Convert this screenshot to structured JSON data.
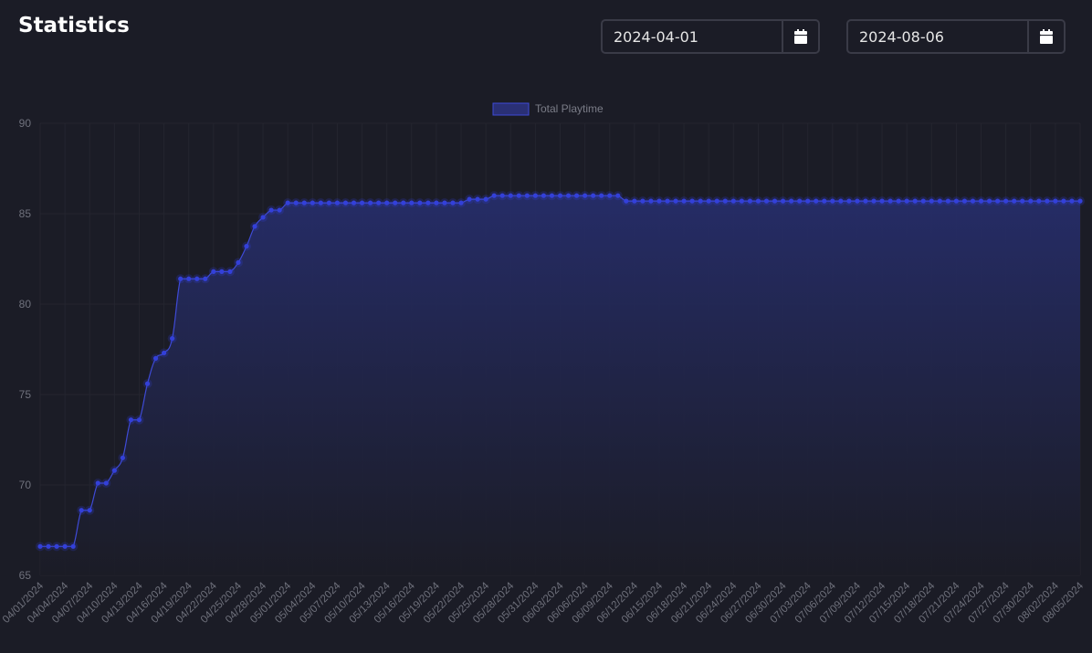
{
  "header": {
    "title": "Statistics",
    "start_date": "2024-04-01",
    "end_date": "2024-08-06",
    "calendar_icon": "calendar-icon"
  },
  "colors": {
    "background": "#1b1c26",
    "line": "#3e4ad6",
    "point": "#3340d9",
    "fill_top": "#262d6a",
    "grid": "#24252f",
    "tick_text": "#6f717c",
    "legend_text": "#7a7c87"
  },
  "chart_data": {
    "type": "line",
    "title": "",
    "xlabel": "",
    "ylabel": "",
    "ylim": [
      65,
      90
    ],
    "y_ticks": [
      65,
      70,
      75,
      80,
      85,
      90
    ],
    "grid": true,
    "legend_position": "top-center",
    "x_tick_labels": [
      "04/01/2024",
      "04/04/2024",
      "04/07/2024",
      "04/10/2024",
      "04/13/2024",
      "04/16/2024",
      "04/19/2024",
      "04/22/2024",
      "04/25/2024",
      "04/28/2024",
      "05/01/2024",
      "05/04/2024",
      "05/07/2024",
      "05/10/2024",
      "05/13/2024",
      "05/16/2024",
      "05/19/2024",
      "05/22/2024",
      "05/25/2024",
      "05/28/2024",
      "05/31/2024",
      "06/03/2024",
      "06/06/2024",
      "06/09/2024",
      "06/12/2024",
      "06/15/2024",
      "06/18/2024",
      "06/21/2024",
      "06/24/2024",
      "06/27/2024",
      "06/30/2024",
      "07/03/2024",
      "07/06/2024",
      "07/09/2024",
      "07/12/2024",
      "07/15/2024",
      "07/18/2024",
      "07/21/2024",
      "07/24/2024",
      "07/27/2024",
      "07/30/2024",
      "08/02/2024",
      "08/05/2024"
    ],
    "series": [
      {
        "name": "Total Playtime",
        "x_start": "2024-04-01",
        "x_end": "2024-08-06",
        "values": [
          66.6,
          66.6,
          66.6,
          66.6,
          66.6,
          68.6,
          68.6,
          70.1,
          70.1,
          70.8,
          71.5,
          73.6,
          73.6,
          75.6,
          77.0,
          77.3,
          78.1,
          81.4,
          81.4,
          81.4,
          81.4,
          81.8,
          81.8,
          81.8,
          82.3,
          83.2,
          84.3,
          84.8,
          85.2,
          85.2,
          85.6,
          85.6,
          85.6,
          85.6,
          85.6,
          85.6,
          85.6,
          85.6,
          85.6,
          85.6,
          85.6,
          85.6,
          85.6,
          85.6,
          85.6,
          85.6,
          85.6,
          85.6,
          85.6,
          85.6,
          85.6,
          85.6,
          85.8,
          85.8,
          85.8,
          86.0,
          86.0,
          86.0,
          86.0,
          86.0,
          86.0,
          86.0,
          86.0,
          86.0,
          86.0,
          86.0,
          86.0,
          86.0,
          86.0,
          86.0,
          86.0,
          85.7,
          85.7,
          85.7,
          85.7,
          85.7,
          85.7,
          85.7,
          85.7,
          85.7,
          85.7,
          85.7,
          85.7,
          85.7,
          85.7,
          85.7,
          85.7,
          85.7,
          85.7,
          85.7,
          85.7,
          85.7,
          85.7,
          85.7,
          85.7,
          85.7,
          85.7,
          85.7,
          85.7,
          85.7,
          85.7,
          85.7,
          85.7,
          85.7,
          85.7,
          85.7,
          85.7,
          85.7,
          85.7,
          85.7,
          85.7,
          85.7,
          85.7,
          85.7,
          85.7,
          85.7,
          85.7,
          85.7,
          85.7,
          85.7,
          85.7,
          85.7,
          85.7,
          85.7,
          85.7,
          85.7,
          85.7
        ]
      }
    ]
  }
}
